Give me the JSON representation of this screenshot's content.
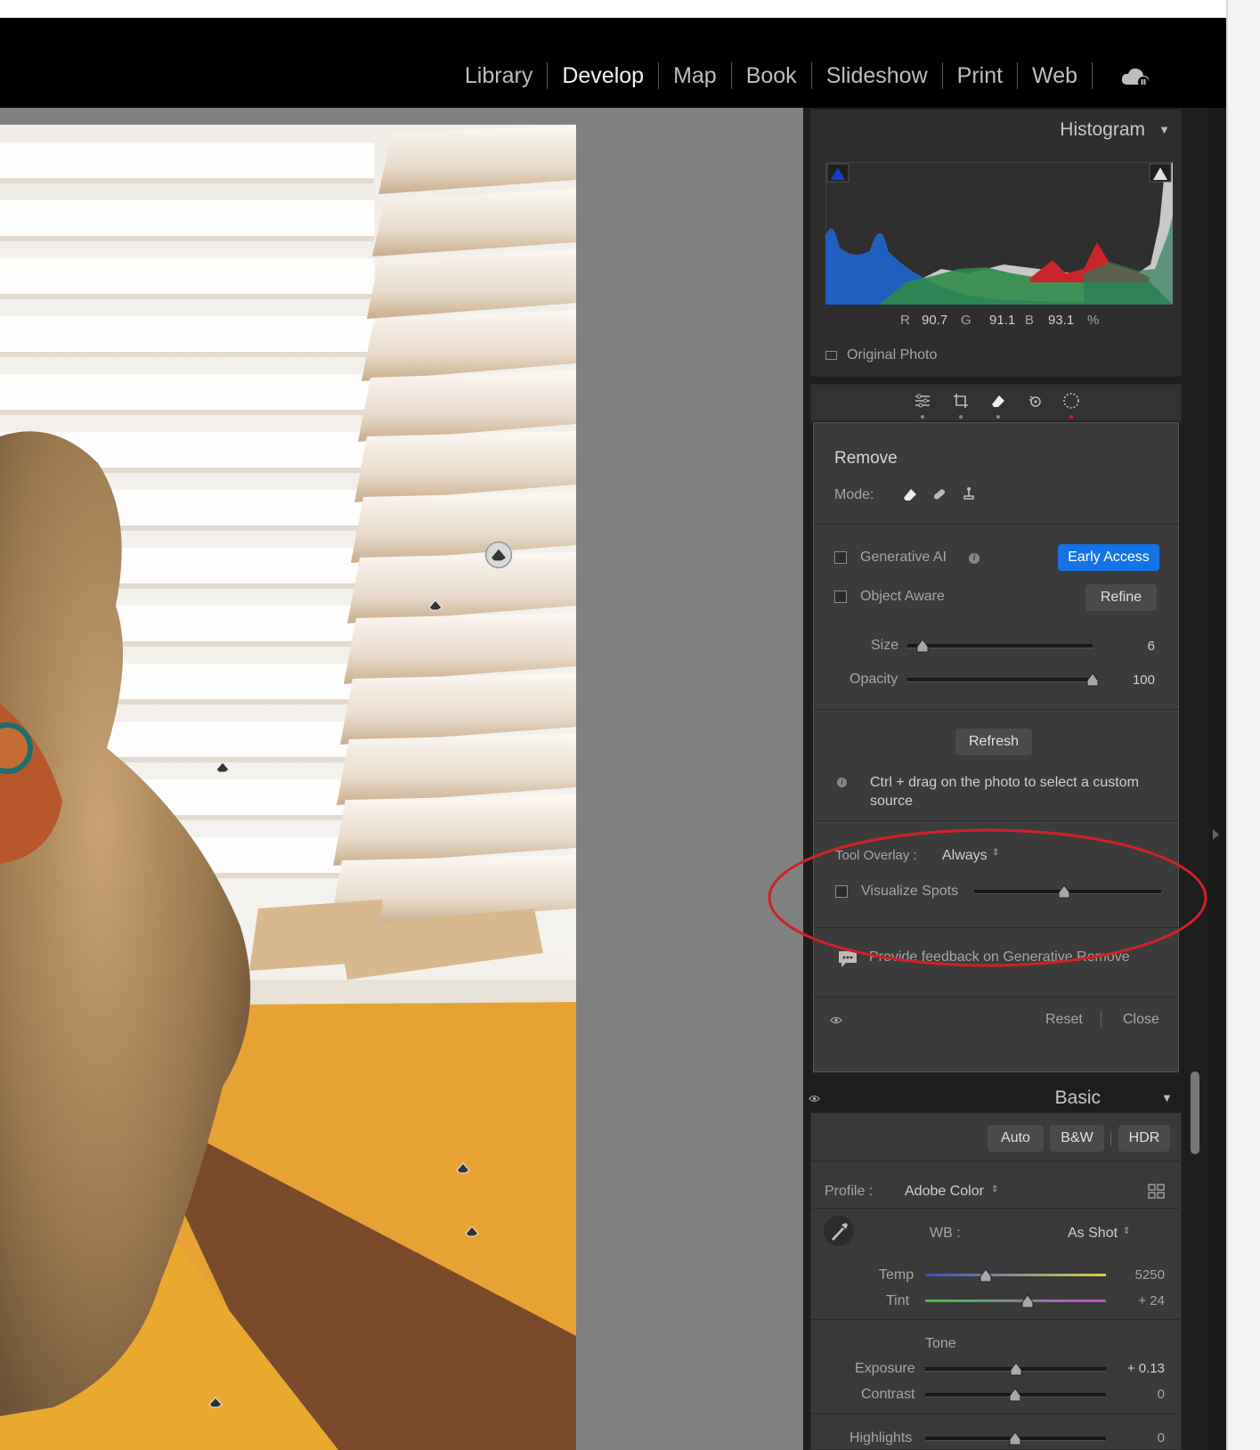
{
  "modules": [
    "Library",
    "Develop",
    "Map",
    "Book",
    "Slideshow",
    "Print",
    "Web"
  ],
  "active_module": "Develop",
  "histogram": {
    "title": "Histogram",
    "r_label": "R",
    "r_value": "90.7",
    "g_label": "G",
    "g_value": "91.1",
    "b_label": "B",
    "b_value": "93.1",
    "percent": "%",
    "original_photo": "Original Photo"
  },
  "remove": {
    "title": "Remove",
    "mode_label": "Mode:",
    "generative_ai": "Generative AI",
    "early_access": "Early Access",
    "object_aware": "Object Aware",
    "refine": "Refine",
    "size_label": "Size",
    "size_value": "6",
    "size_fraction": 0.08,
    "opacity_label": "Opacity",
    "opacity_value": "100",
    "opacity_fraction": 1.0,
    "refresh": "Refresh",
    "hint": "Ctrl + drag on the photo to select a custom source",
    "tool_overlay_label": "Tool Overlay :",
    "tool_overlay_value": "Always",
    "visualize_spots": "Visualize Spots",
    "visualize_fraction": 0.48,
    "feedback": "Provide feedback on Generative Remove",
    "reset": "Reset",
    "close": "Close"
  },
  "basic": {
    "title": "Basic",
    "auto": "Auto",
    "bw": "B&W",
    "hdr": "HDR",
    "profile_label": "Profile :",
    "profile_value": "Adobe Color",
    "wb_label": "WB :",
    "wb_value": "As Shot",
    "temp_label": "Temp",
    "temp_value": "5250",
    "tint_label": "Tint",
    "tint_value": "+ 24",
    "tone_label": "Tone",
    "exposure_label": "Exposure",
    "exposure_value": "+ 0.13",
    "contrast_label": "Contrast",
    "contrast_value": "0",
    "highlights_label": "Highlights",
    "highlights_value": "0"
  },
  "colors": {
    "annotation_ellipse": "#d0202a",
    "early_access": "#1473e6",
    "panel_bg": "#3a3a3a"
  }
}
